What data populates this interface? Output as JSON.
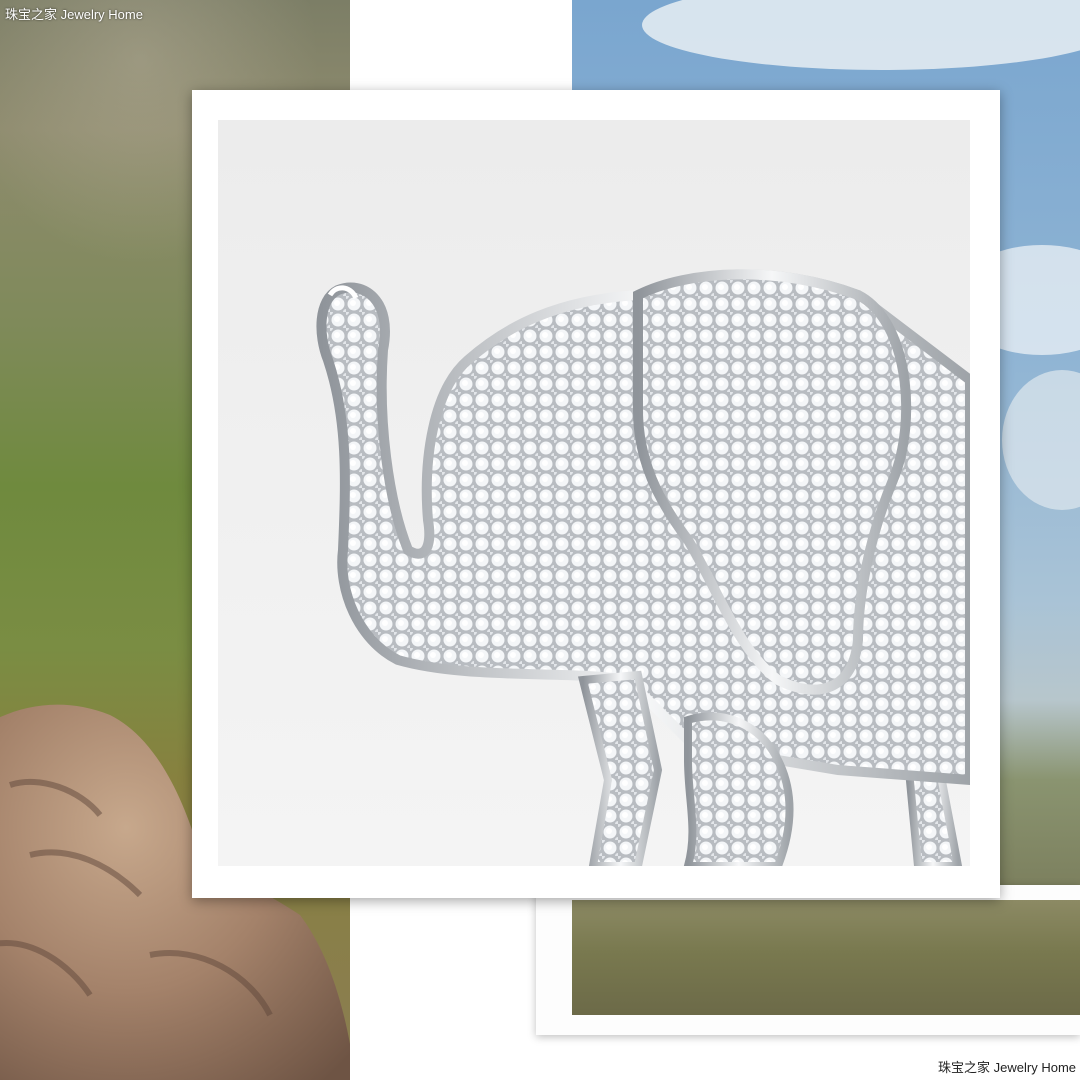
{
  "watermark": {
    "top_left": "珠宝之家  Jewelry Home",
    "bottom_right": "珠宝之家  Jewelry Home"
  },
  "photos": {
    "left_scene": "savanna-with-rock",
    "right_scene": "sky-over-savanna",
    "center_subject": "diamond-elephant-brooch"
  },
  "colors": {
    "frame": "#ffffff",
    "sky": "#8fb1cf",
    "grass": "#6f8a3e",
    "rock": "#a4826a",
    "platinum": "#c9cdd2"
  }
}
